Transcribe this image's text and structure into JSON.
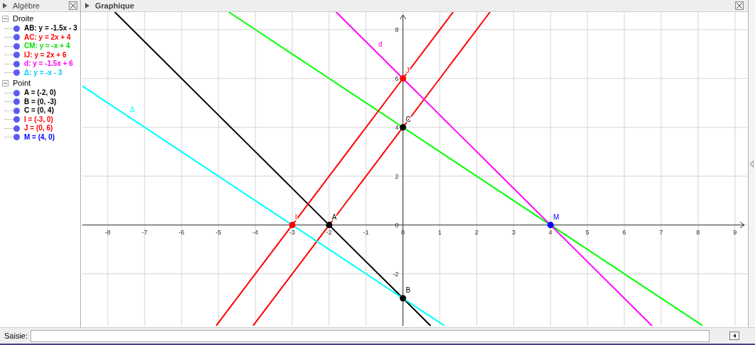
{
  "algebra": {
    "title": "Algèbre",
    "groups": [
      {
        "label": "Droite",
        "expanded": true,
        "children": [
          {
            "text": "AB: y = -1.5x - 3",
            "color": "#000000"
          },
          {
            "text": "AC: y = 2x + 4",
            "color": "#ff0000"
          },
          {
            "text": "CM: y = -x + 4",
            "color": "#00dd00"
          },
          {
            "text": "IJ: y = 2x + 6",
            "color": "#ff0000"
          },
          {
            "text": "d: y = -1.5x + 6",
            "color": "#ff00ff"
          },
          {
            "text": "Δ: y = -x - 3",
            "color": "#00ccff"
          }
        ]
      },
      {
        "label": "Point",
        "expanded": true,
        "children": [
          {
            "text": "A = (-2, 0)",
            "color": "#000000"
          },
          {
            "text": "B = (0, -3)",
            "color": "#000000"
          },
          {
            "text": "C = (0, 4)",
            "color": "#000000"
          },
          {
            "text": "I = (-3, 0)",
            "color": "#ff0000"
          },
          {
            "text": "J = (0, 6)",
            "color": "#ff0000"
          },
          {
            "text": "M = (4, 0)",
            "color": "#0000ff"
          }
        ]
      }
    ]
  },
  "graphics": {
    "title": "Graphique",
    "chart_data": {
      "type": "line",
      "grid": true,
      "x": [
        -8.69,
        -7.81,
        -5.06,
        -4.72,
        -4.06,
        -3,
        -2,
        -1.81,
        0,
        0.75,
        1.12,
        1.36,
        2.36,
        4,
        6.75,
        8.12
      ],
      "xlim": [
        -8.69,
        9.33
      ],
      "ylim": [
        -4.13,
        8.72
      ],
      "xticks": [
        -8,
        -7,
        -6,
        -5,
        -4,
        -3,
        -2,
        -1,
        0,
        1,
        2,
        3,
        4,
        5,
        6,
        7,
        8,
        9
      ],
      "yticks": [
        -2,
        0,
        2,
        4,
        6,
        8
      ],
      "series": [
        {
          "color": "#000000",
          "values": [
            null,
            8.72,
            4.59,
            4.08,
            3.09,
            1.5,
            0,
            -0.29,
            -3,
            -4.13,
            null,
            null,
            null,
            null,
            null,
            null
          ]
        },
        {
          "color": "#ff0000",
          "values": [
            null,
            null,
            null,
            null,
            -4.12,
            -2,
            0,
            0.38,
            4,
            5.5,
            6.24,
            6.72,
            8.72,
            null,
            null,
            null
          ]
        },
        {
          "color": "#00ff00",
          "values": [
            null,
            null,
            null,
            8.72,
            8.06,
            7,
            6,
            5.81,
            4,
            3.25,
            2.88,
            2.64,
            1.64,
            0,
            -2.75,
            -4.12
          ]
        },
        {
          "color": "#ff0000",
          "values": [
            null,
            null,
            -4.12,
            -3.44,
            -2.12,
            0,
            2,
            2.38,
            6,
            7.5,
            8.24,
            8.72,
            null,
            null,
            null,
            null
          ]
        },
        {
          "name": "d",
          "color": "#ff00ff",
          "values": [
            null,
            null,
            null,
            null,
            null,
            null,
            null,
            8.72,
            6,
            4.88,
            4.32,
            3.96,
            2.46,
            0,
            -4.13,
            null
          ]
        },
        {
          "name": "Δ",
          "color": "#00ffff",
          "values": [
            5.69,
            4.81,
            2.06,
            1.72,
            1.06,
            0,
            -1,
            -1.19,
            -3,
            -3.75,
            -4.12,
            null,
            null,
            null,
            null,
            null
          ]
        },
        {
          "name": "A",
          "color": "#000000",
          "marker": true,
          "values": [
            null,
            null,
            null,
            null,
            null,
            null,
            0,
            null,
            null,
            null,
            null,
            null,
            null,
            null,
            null,
            null
          ]
        },
        {
          "name": "B",
          "color": "#000000",
          "marker": true,
          "values": [
            null,
            null,
            null,
            null,
            null,
            null,
            null,
            null,
            -3,
            null,
            null,
            null,
            null,
            null,
            null,
            null
          ]
        },
        {
          "name": "C",
          "color": "#000000",
          "marker": true,
          "values": [
            null,
            null,
            null,
            null,
            null,
            null,
            null,
            null,
            4,
            null,
            null,
            null,
            null,
            null,
            null,
            null
          ]
        },
        {
          "name": "I",
          "color": "#ff0000",
          "marker": true,
          "values": [
            null,
            null,
            null,
            null,
            null,
            0,
            null,
            null,
            null,
            null,
            null,
            null,
            null,
            null,
            null,
            null
          ]
        },
        {
          "name": "J",
          "color": "#ff0000",
          "marker": true,
          "values": [
            null,
            null,
            null,
            null,
            null,
            null,
            null,
            null,
            6,
            null,
            null,
            null,
            null,
            null,
            null,
            null
          ]
        },
        {
          "name": "M",
          "color": "#0000ff",
          "marker": true,
          "values": [
            null,
            null,
            null,
            null,
            null,
            null,
            null,
            null,
            null,
            null,
            null,
            null,
            null,
            0,
            null,
            null
          ]
        }
      ]
    }
  },
  "input_bar": {
    "label": "Saisie:"
  }
}
